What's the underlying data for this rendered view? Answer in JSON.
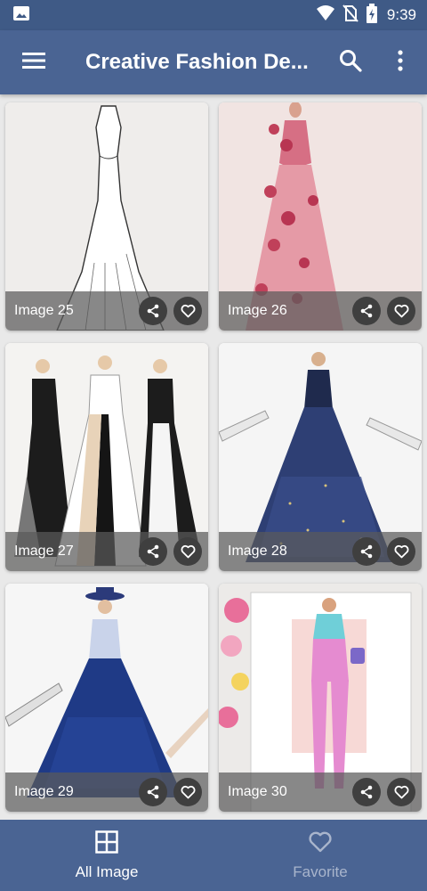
{
  "status_bar": {
    "time": "9:39",
    "icons": [
      "image-icon",
      "wifi-icon",
      "no-sim-icon",
      "battery-charging-icon"
    ]
  },
  "app_bar": {
    "title": "Creative Fashion De...",
    "icons": [
      "menu-icon",
      "search-icon",
      "more-vert-icon"
    ]
  },
  "images": [
    {
      "label": "Image 25"
    },
    {
      "label": "Image 26"
    },
    {
      "label": "Image 27"
    },
    {
      "label": "Image 28"
    },
    {
      "label": "Image 29"
    },
    {
      "label": "Image 30"
    }
  ],
  "card_actions": [
    "share-icon",
    "favorite-outline-icon"
  ],
  "bottom_nav": {
    "items": [
      {
        "label": "All Image",
        "icon": "grid-icon",
        "active": true
      },
      {
        "label": "Favorite",
        "icon": "heart-outline-icon",
        "active": false
      }
    ]
  },
  "colors": {
    "status_bar": "#3f5a86",
    "app_bar": "#4a6493",
    "bottom_nav": "#4a6493",
    "inactive_nav": "#a9b5cc"
  }
}
